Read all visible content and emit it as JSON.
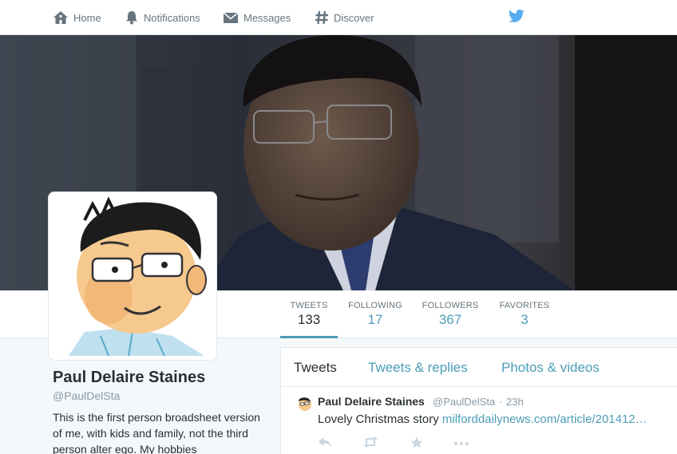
{
  "nav": {
    "home": "Home",
    "notifications": "Notifications",
    "messages": "Messages",
    "discover": "Discover",
    "icons": [
      "home-icon",
      "bell-icon",
      "envelope-icon",
      "hash-icon",
      "twitter-bird-icon"
    ],
    "brand_color": "#55acee"
  },
  "stats": {
    "tweets": {
      "label": "TWEETS",
      "value": "133"
    },
    "following": {
      "label": "FOLLOWING",
      "value": "17"
    },
    "followers": {
      "label": "FOLLOWERS",
      "value": "367"
    },
    "favorites": {
      "label": "FAVORITES",
      "value": "3"
    }
  },
  "profile": {
    "name": "Paul Delaire Staines",
    "handle": "@PaulDelSta",
    "bio": "This is the first person broadsheet version of me, with kids and family, not the third person alter ego. My hobbies"
  },
  "timeline": {
    "tabs": [
      "Tweets",
      "Tweets & replies",
      "Photos & videos"
    ],
    "tweet": {
      "name": "Paul Delaire Staines",
      "handle": "@PaulDelSta",
      "dot": "·",
      "time": "23h",
      "text": "Lovely Christmas story",
      "link": "milforddailynews.com/article/201412…"
    }
  },
  "colors": {
    "link": "#4c9db7",
    "muted": "#66757f",
    "text": "#292f33"
  }
}
